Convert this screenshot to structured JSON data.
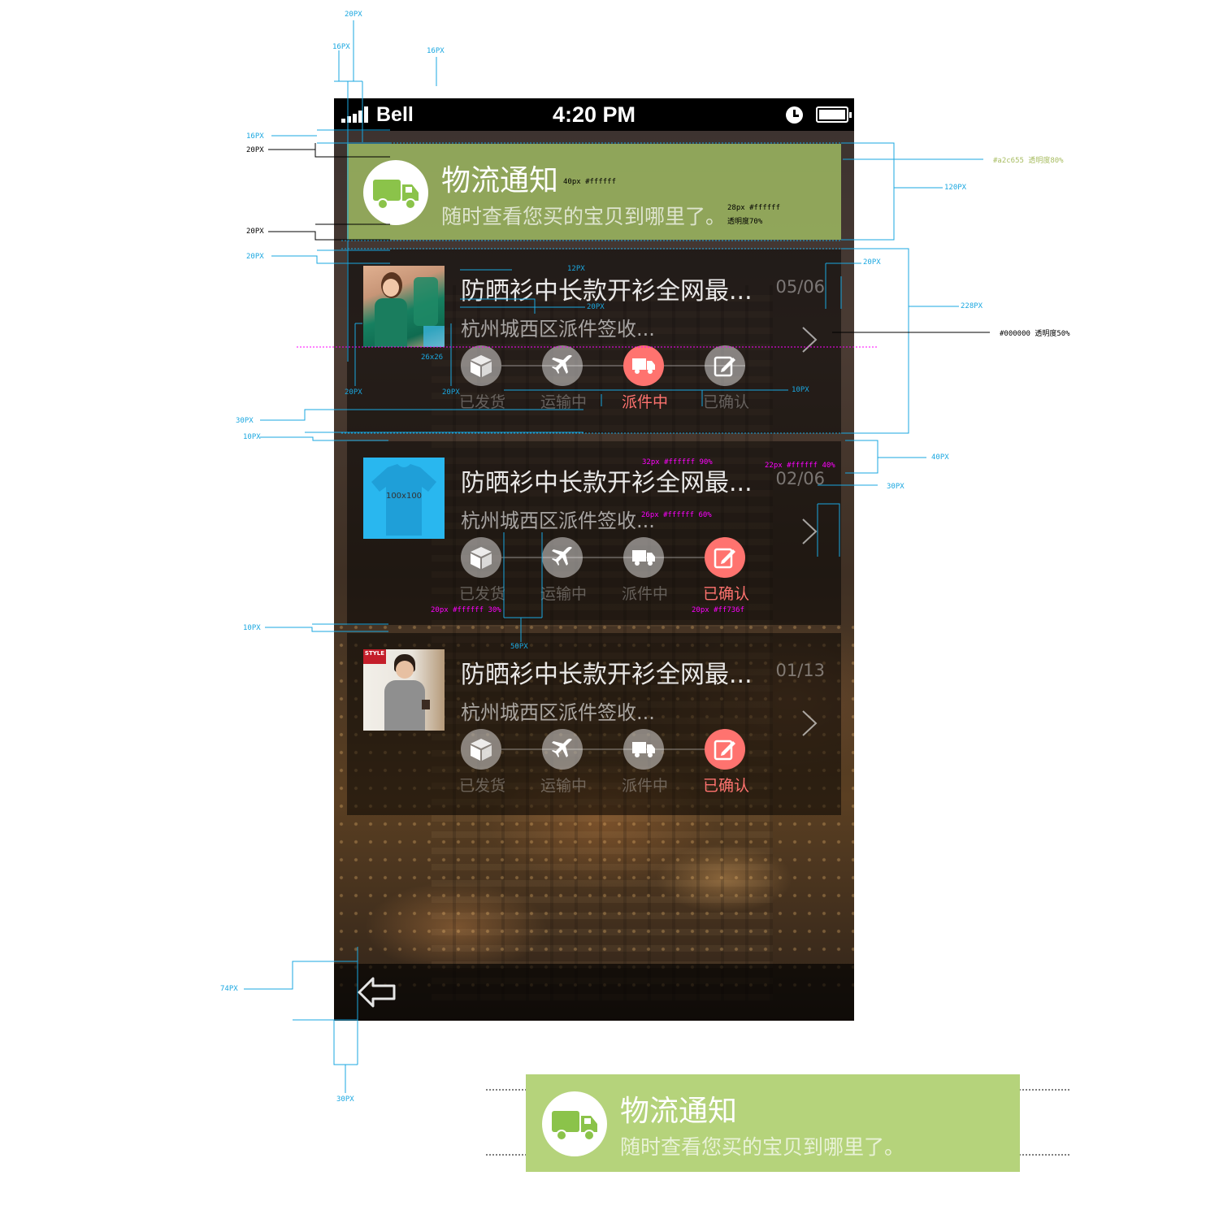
{
  "status_bar": {
    "carrier": "Bell",
    "time": "4:20 PM"
  },
  "banner": {
    "title": "物流通知",
    "subtitle": "随时查看您买的宝贝到哪里了。",
    "color": "#a4c265"
  },
  "step_labels": [
    "已发货",
    "运输中",
    "派件中",
    "已确认"
  ],
  "step_icons": [
    "box-icon",
    "plane-icon",
    "truck-icon",
    "edit-icon"
  ],
  "accent_color": "#ff736f",
  "orders": [
    {
      "title": "防晒衫中长款开衫全网最...",
      "location": "杭州城西区派件签收...",
      "date": "05/06",
      "active_step": 2,
      "thumb": "woman-green-cardigan",
      "thumb_text": ""
    },
    {
      "title": "防晒衫中长款开衫全网最...",
      "location": "杭州城西区派件签收...",
      "date": "02/06",
      "active_step": 3,
      "thumb": "placeholder-tshirt",
      "thumb_text": "100x100"
    },
    {
      "title": "防晒衫中长款开衫全网最...",
      "location": "杭州城西区派件签收...",
      "date": "01/13",
      "active_step": 3,
      "thumb": "man-grey-sweater",
      "thumb_text": "STYLE"
    }
  ],
  "annotations": {
    "a_20px": "20PX",
    "a_16px": "16PX",
    "a_12px": "12PX",
    "a_10px": "10PX",
    "a_30px": "30PX",
    "a_40px": "40PX",
    "a_50px": "50PX",
    "a_74px": "74PX",
    "a_120px": "120PX",
    "a_228px": "228PX",
    "a_26x26": "26x26",
    "title_spec": "40px   #ffffff",
    "sub_spec_1": "28px   #ffffff",
    "sub_spec_2": "透明度70%",
    "banner_color_spec": "#a2c655   透明度80%",
    "card_bg_spec": "#000000  透明度50%",
    "card_title_spec": "32px   #ffffff   90%",
    "card_date_spec": "22px   #ffffff 40%",
    "card_sub_spec": "26px    #ffffff   60%",
    "step_off_spec": "20px   #ffffff   30%",
    "step_on_spec": "20px   #ff736f"
  }
}
